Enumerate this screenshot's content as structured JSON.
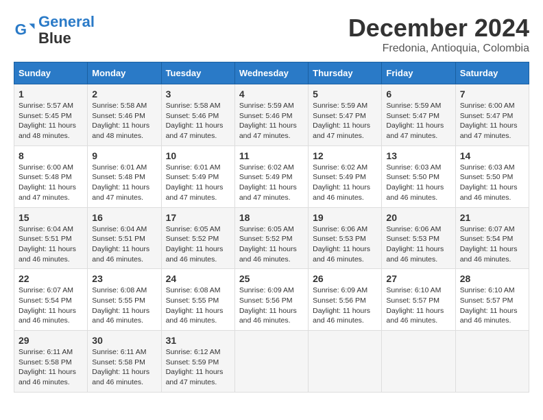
{
  "logo": {
    "line1": "General",
    "line2": "Blue"
  },
  "title": "December 2024",
  "subtitle": "Fredonia, Antioquia, Colombia",
  "days_of_week": [
    "Sunday",
    "Monday",
    "Tuesday",
    "Wednesday",
    "Thursday",
    "Friday",
    "Saturday"
  ],
  "weeks": [
    [
      {
        "day": "1",
        "sunrise": "5:57 AM",
        "sunset": "5:45 PM",
        "daylight": "11 hours and 48 minutes."
      },
      {
        "day": "2",
        "sunrise": "5:58 AM",
        "sunset": "5:46 PM",
        "daylight": "11 hours and 48 minutes."
      },
      {
        "day": "3",
        "sunrise": "5:58 AM",
        "sunset": "5:46 PM",
        "daylight": "11 hours and 47 minutes."
      },
      {
        "day": "4",
        "sunrise": "5:59 AM",
        "sunset": "5:46 PM",
        "daylight": "11 hours and 47 minutes."
      },
      {
        "day": "5",
        "sunrise": "5:59 AM",
        "sunset": "5:47 PM",
        "daylight": "11 hours and 47 minutes."
      },
      {
        "day": "6",
        "sunrise": "5:59 AM",
        "sunset": "5:47 PM",
        "daylight": "11 hours and 47 minutes."
      },
      {
        "day": "7",
        "sunrise": "6:00 AM",
        "sunset": "5:47 PM",
        "daylight": "11 hours and 47 minutes."
      }
    ],
    [
      {
        "day": "8",
        "sunrise": "6:00 AM",
        "sunset": "5:48 PM",
        "daylight": "11 hours and 47 minutes."
      },
      {
        "day": "9",
        "sunrise": "6:01 AM",
        "sunset": "5:48 PM",
        "daylight": "11 hours and 47 minutes."
      },
      {
        "day": "10",
        "sunrise": "6:01 AM",
        "sunset": "5:49 PM",
        "daylight": "11 hours and 47 minutes."
      },
      {
        "day": "11",
        "sunrise": "6:02 AM",
        "sunset": "5:49 PM",
        "daylight": "11 hours and 47 minutes."
      },
      {
        "day": "12",
        "sunrise": "6:02 AM",
        "sunset": "5:49 PM",
        "daylight": "11 hours and 46 minutes."
      },
      {
        "day": "13",
        "sunrise": "6:03 AM",
        "sunset": "5:50 PM",
        "daylight": "11 hours and 46 minutes."
      },
      {
        "day": "14",
        "sunrise": "6:03 AM",
        "sunset": "5:50 PM",
        "daylight": "11 hours and 46 minutes."
      }
    ],
    [
      {
        "day": "15",
        "sunrise": "6:04 AM",
        "sunset": "5:51 PM",
        "daylight": "11 hours and 46 minutes."
      },
      {
        "day": "16",
        "sunrise": "6:04 AM",
        "sunset": "5:51 PM",
        "daylight": "11 hours and 46 minutes."
      },
      {
        "day": "17",
        "sunrise": "6:05 AM",
        "sunset": "5:52 PM",
        "daylight": "11 hours and 46 minutes."
      },
      {
        "day": "18",
        "sunrise": "6:05 AM",
        "sunset": "5:52 PM",
        "daylight": "11 hours and 46 minutes."
      },
      {
        "day": "19",
        "sunrise": "6:06 AM",
        "sunset": "5:53 PM",
        "daylight": "11 hours and 46 minutes."
      },
      {
        "day": "20",
        "sunrise": "6:06 AM",
        "sunset": "5:53 PM",
        "daylight": "11 hours and 46 minutes."
      },
      {
        "day": "21",
        "sunrise": "6:07 AM",
        "sunset": "5:54 PM",
        "daylight": "11 hours and 46 minutes."
      }
    ],
    [
      {
        "day": "22",
        "sunrise": "6:07 AM",
        "sunset": "5:54 PM",
        "daylight": "11 hours and 46 minutes."
      },
      {
        "day": "23",
        "sunrise": "6:08 AM",
        "sunset": "5:55 PM",
        "daylight": "11 hours and 46 minutes."
      },
      {
        "day": "24",
        "sunrise": "6:08 AM",
        "sunset": "5:55 PM",
        "daylight": "11 hours and 46 minutes."
      },
      {
        "day": "25",
        "sunrise": "6:09 AM",
        "sunset": "5:56 PM",
        "daylight": "11 hours and 46 minutes."
      },
      {
        "day": "26",
        "sunrise": "6:09 AM",
        "sunset": "5:56 PM",
        "daylight": "11 hours and 46 minutes."
      },
      {
        "day": "27",
        "sunrise": "6:10 AM",
        "sunset": "5:57 PM",
        "daylight": "11 hours and 46 minutes."
      },
      {
        "day": "28",
        "sunrise": "6:10 AM",
        "sunset": "5:57 PM",
        "daylight": "11 hours and 46 minutes."
      }
    ],
    [
      {
        "day": "29",
        "sunrise": "6:11 AM",
        "sunset": "5:58 PM",
        "daylight": "11 hours and 46 minutes."
      },
      {
        "day": "30",
        "sunrise": "6:11 AM",
        "sunset": "5:58 PM",
        "daylight": "11 hours and 46 minutes."
      },
      {
        "day": "31",
        "sunrise": "6:12 AM",
        "sunset": "5:59 PM",
        "daylight": "11 hours and 47 minutes."
      },
      null,
      null,
      null,
      null
    ]
  ]
}
